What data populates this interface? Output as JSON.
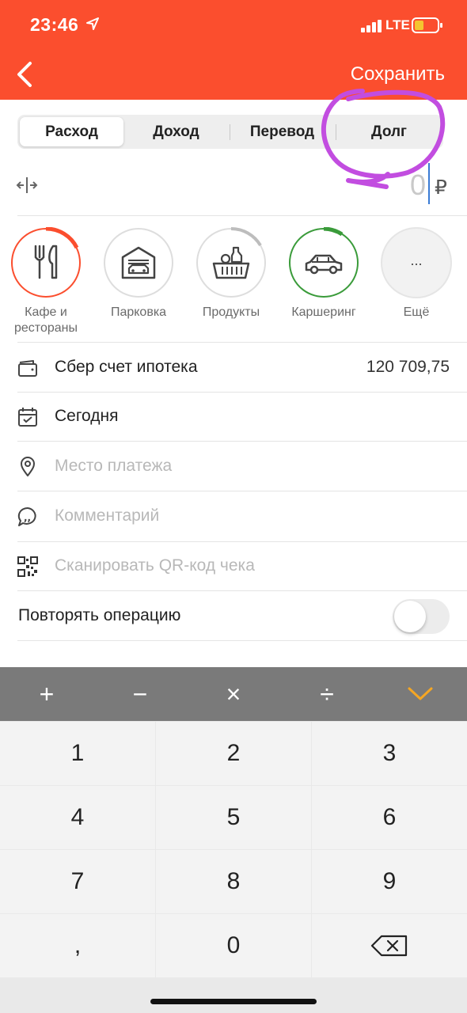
{
  "status_bar": {
    "time": "23:46",
    "network": "LTE",
    "icons": [
      "location-arrow-icon",
      "signal-bars-icon",
      "battery-low-icon"
    ],
    "battery_color": "#f4c430"
  },
  "header": {
    "back_icon": "chevron-left-icon",
    "save_label": "Сохранить",
    "color": "#fb4e2e"
  },
  "tabs": [
    {
      "label": "Расход",
      "active": true
    },
    {
      "label": "Доход",
      "active": false
    },
    {
      "label": "Перевод",
      "active": false
    },
    {
      "label": "Долг",
      "active": false
    }
  ],
  "amount": {
    "value": "0",
    "currency": "₽",
    "swap_icon": "swap-horizontal-icon"
  },
  "categories": [
    {
      "label": "Кафе и рестораны",
      "icon": "fork-knife-icon",
      "ring_color": "#fb4e2e",
      "progress": 0.12
    },
    {
      "label": "Парковка",
      "icon": "garage-icon",
      "ring_color": "#dddddd",
      "progress": 0
    },
    {
      "label": "Продукты",
      "icon": "grocery-basket-icon",
      "ring_color": "#bdbdbd",
      "progress": 0.1
    },
    {
      "label": "Каршеринг",
      "icon": "car-icon",
      "ring_color": "#3a9b3a",
      "progress": 0.08
    },
    {
      "label": "Ещё",
      "icon": "more-dots-icon",
      "ring_color": "#e5e5e5",
      "progress": 0
    }
  ],
  "more_dots": "...",
  "rows": {
    "account": {
      "label": "Сбер счет ипотека",
      "value": "120 709,75",
      "icon": "wallet-icon"
    },
    "date": {
      "label": "Сегодня",
      "icon": "calendar-icon"
    },
    "place": {
      "placeholder": "Место платежа",
      "icon": "location-pin-icon"
    },
    "comment": {
      "placeholder": "Комментарий",
      "icon": "speech-bubble-icon"
    },
    "qr": {
      "placeholder": "Сканировать QR-код чека",
      "icon": "qr-code-icon"
    }
  },
  "repeat": {
    "label": "Повторять операцию",
    "enabled": false
  },
  "operators": [
    "+",
    "−",
    "×",
    "÷"
  ],
  "confirm_icon": "chevron-down-icon",
  "confirm_color": "#f5a623",
  "keys": [
    "1",
    "2",
    "3",
    "4",
    "5",
    "6",
    "7",
    "8",
    "9",
    ",",
    "0"
  ],
  "backspace_icon": "backspace-icon"
}
